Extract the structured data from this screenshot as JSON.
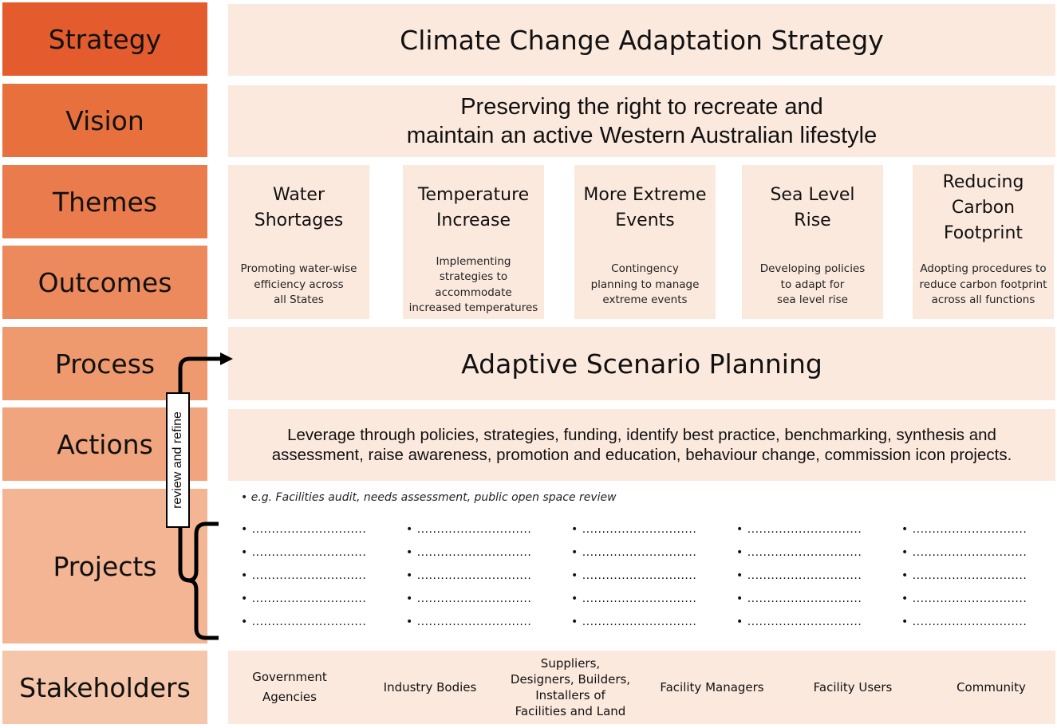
{
  "rows": {
    "strategy": {
      "label": "Strategy",
      "color": "#e45c2e"
    },
    "vision": {
      "label": "Vision",
      "color": "#e8703d"
    },
    "themes": {
      "label": "Themes",
      "color": "#ea7b4c"
    },
    "outcomes": {
      "label": "Outcomes",
      "color": "#ec8a5d"
    },
    "process": {
      "label": "Process",
      "color": "#ee9a6e"
    },
    "actions": {
      "label": "Actions",
      "color": "#f0a57e"
    },
    "projects": {
      "label": "Projects",
      "color": "#f3b594"
    },
    "stakeholders": {
      "label": "Stakeholders",
      "color": "#f5c6a9"
    }
  },
  "strategy": {
    "title": "Climate Change Adaptation Strategy"
  },
  "vision": {
    "line1": "Preserving the right to recreate and",
    "line2": "maintain an active Western Australian lifestyle"
  },
  "themes": [
    {
      "title": [
        "Water",
        "Shortages"
      ],
      "outcome": [
        "Promoting water-wise",
        "efficiency across",
        "all States"
      ]
    },
    {
      "title": [
        "Temperature",
        "Increase"
      ],
      "outcome": [
        "Implementing",
        "strategies to",
        "accommodate",
        "increased temperatures"
      ]
    },
    {
      "title": [
        "More Extreme",
        "Events"
      ],
      "outcome": [
        "Contingency",
        "planning to manage",
        "extreme events"
      ]
    },
    {
      "title": [
        "Sea Level",
        "Rise"
      ],
      "outcome": [
        "Developing policies",
        "to adapt for",
        "sea level rise"
      ]
    },
    {
      "title": [
        "Reducing",
        "Carbon",
        "Footprint"
      ],
      "outcome": [
        "Adopting procedures to",
        "reduce carbon footprint",
        "across all functions"
      ]
    }
  ],
  "process": {
    "title": "Adaptive Scenario Planning"
  },
  "actions": {
    "line1": "Leverage through policies, strategies, funding, identify best practice, benchmarking, synthesis and",
    "line2": "assessment, raise awareness, promotion and education, behaviour change, commission icon projects."
  },
  "projects": {
    "example": "• e.g. Facilities audit, needs assessment, public open space review",
    "placeholder": "• .............................",
    "columns": 5,
    "rows_per_column": 5
  },
  "review": {
    "label": "review and refine"
  },
  "stakeholders": [
    [
      "Government",
      "Agencies"
    ],
    [
      "Industry Bodies"
    ],
    [
      "Suppliers,",
      "Designers, Builders,",
      "Installers of",
      "Facilities and Land"
    ],
    [
      "Facility Managers"
    ],
    [
      "Facility Users"
    ],
    [
      "Community"
    ]
  ],
  "colors": {
    "panel": "#fce9de",
    "connector": "#000000"
  }
}
